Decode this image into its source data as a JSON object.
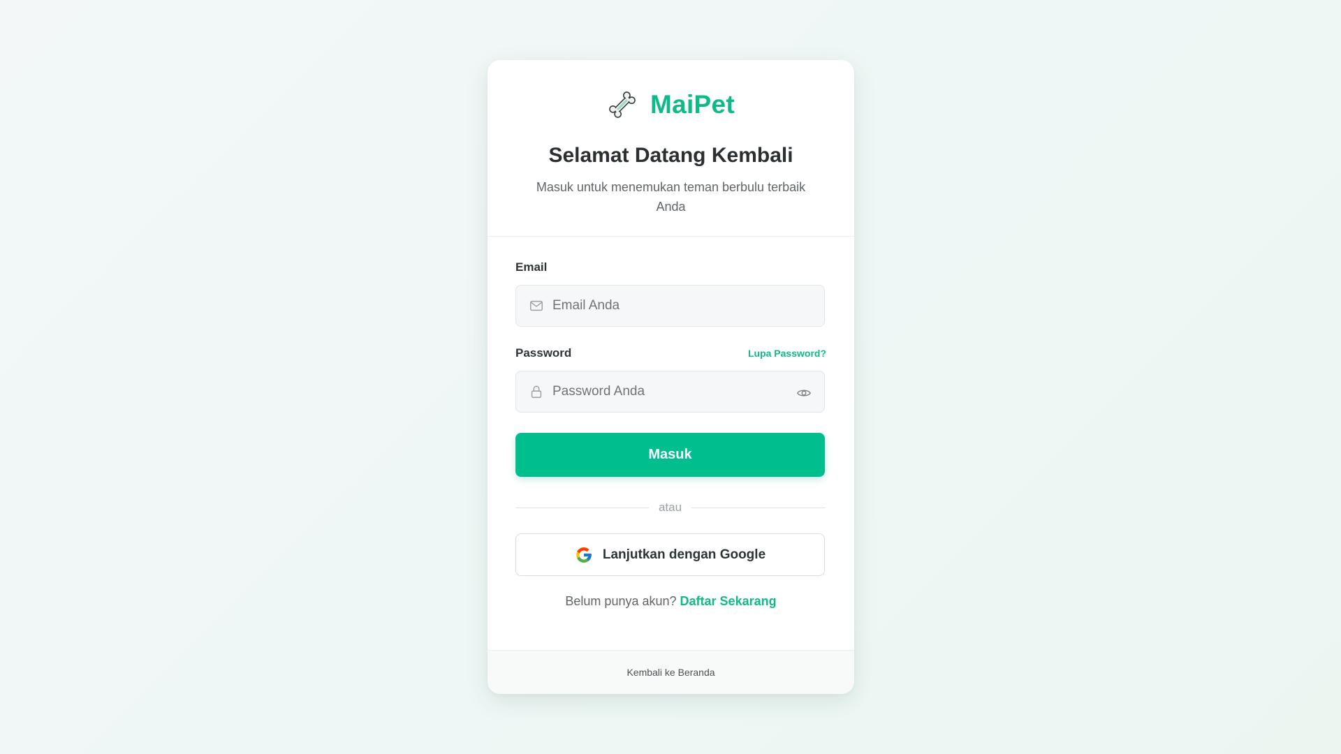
{
  "brand": {
    "name": "MaiPet",
    "icon": "bone-icon",
    "accent_color": "#10b98a"
  },
  "header": {
    "title": "Selamat Datang Kembali",
    "subtitle": "Masuk untuk menemukan teman berbulu terbaik Anda"
  },
  "form": {
    "email": {
      "label": "Email",
      "placeholder": "Email Anda",
      "value": "",
      "icon": "mail-icon"
    },
    "password": {
      "label": "Password",
      "placeholder": "Password Anda",
      "value": "",
      "icon": "lock-icon",
      "toggle_icon": "eye-icon",
      "forgot_label": "Lupa Password?"
    },
    "submit_label": "Masuk",
    "submit_color": "#00be8e"
  },
  "divider_text": "atau",
  "google": {
    "label": "Lanjutkan dengan Google",
    "icon": "google-icon"
  },
  "signup": {
    "prompt": "Belum punya akun?",
    "link_label": "Daftar Sekarang"
  },
  "footer": {
    "back_label": "Kembali ke Beranda"
  }
}
